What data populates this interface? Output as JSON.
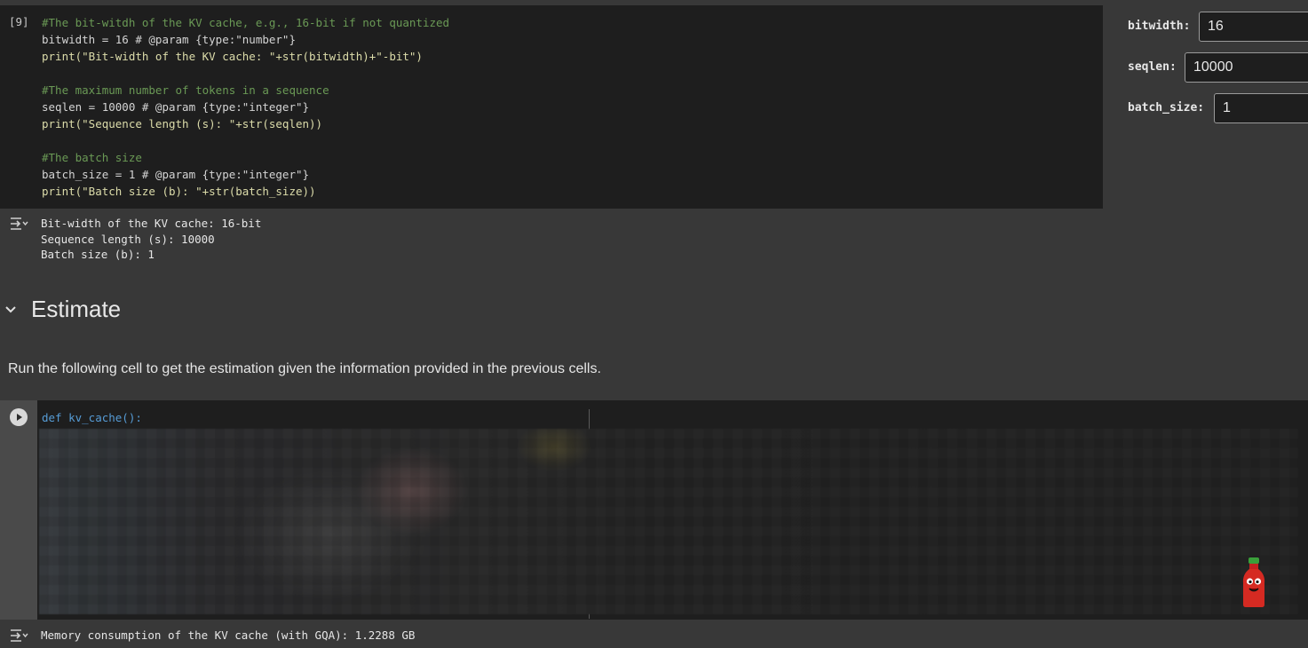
{
  "cell1": {
    "exec_count": "[9]",
    "lines": [
      "#The bit-witdh of the KV cache, e.g., 16-bit if not quantized",
      "bitwidth = 16 # @param {type:\"number\"}",
      "print(\"Bit-width of the KV cache: \"+str(bitwidth)+\"-bit\")",
      "#The maximum number of tokens in a sequence",
      "seqlen = 10000 # @param {type:\"integer\"}",
      "print(\"Sequence length (s): \"+str(seqlen))",
      "#The batch size",
      "batch_size = 1 # @param {type:\"integer\"}",
      "print(\"Batch size (b): \"+str(batch_size))"
    ]
  },
  "form": {
    "bitwidth_label": "bitwidth:",
    "bitwidth_value": "16",
    "seqlen_label": "seqlen:",
    "seqlen_value": "10000",
    "batch_size_label": "batch_size:",
    "batch_size_value": "1"
  },
  "output1": {
    "lines": [
      "Bit-width of the KV cache: 16-bit",
      "Sequence length (s): 10000",
      "Batch size (b): 1"
    ]
  },
  "section": {
    "heading": "Estimate",
    "paragraph": "Run the following cell to get the estimation given the information provided in the previous cells."
  },
  "cell2": {
    "first_line": "def kv_cache():"
  },
  "output2": {
    "line": "Memory consumption of the KV cache (with GQA): 1.2288 GB"
  },
  "colors": {
    "background": "#383838",
    "cell_background": "#1e1e1e",
    "comment": "#6a9955",
    "string": "#ce9178",
    "function": "#dcdcaa",
    "builtin": "#4ec9b0",
    "keyword": "#569cd6"
  },
  "icons": {
    "output_toggle": "output-toggle-icon",
    "chevron": "chevron-down-icon",
    "run": "play-icon"
  }
}
